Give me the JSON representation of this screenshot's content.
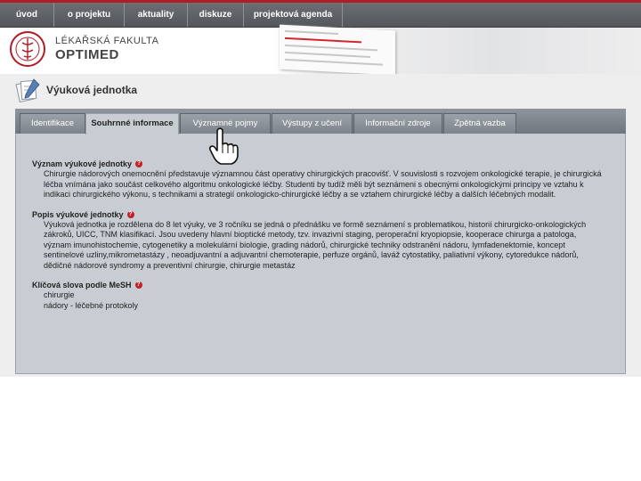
{
  "nav": {
    "items": [
      "úvod",
      "o projektu",
      "aktuality",
      "diskuze",
      "projektová agenda"
    ]
  },
  "logo": {
    "line1": "LÉKAŘSKÁ FAKULTA",
    "line2": "OPTIMED"
  },
  "page": {
    "title": "Výuková jednotka"
  },
  "tabs": [
    {
      "label": "Identifikace",
      "active": false
    },
    {
      "label": "Souhrnné informace",
      "active": true
    },
    {
      "label": "Významné pojmy",
      "active": false
    },
    {
      "label": "Výstupy z učení",
      "active": false
    },
    {
      "label": "Informační zdroje",
      "active": false
    },
    {
      "label": "Zpětná vazba",
      "active": false
    }
  ],
  "sections": {
    "vyznam": {
      "title": "Význam výukové jednotky",
      "text": "Chirurgie nádorových onemocnění představuje významnou část operativy chirurgických pracovišť. V souvislosti s rozvojem onkologické terapie, je chirurgická léčba vnímána jako součást celkového algoritmu onkologické léčby. Studenti by tudíž měli být seznámeni s obecnými onkologickými principy ve vztahu k indikaci chirurgického výkonu, s technikami a strategií onkologicko-chirurgické léčby a se vztahem chirurgické léčby a dalších léčebných modalit."
    },
    "popis": {
      "title": "Popis výukové jednotky",
      "text": "Výuková jednotka je rozdělena do 8 let výuky, ve 3 ročníku se jedná o přednášku ve formě seznámení s problematikou, historií chirurgicko-onkologických zákroků, UICC, TNM klasifikací. Jsou uvedeny hlavní bioptické metody, tzv. invazivní staging, peroperační kryopiopsie, kooperace chirurga a patologa, význam imunohistochemie, cytogenetiky a molekulární biologie, grading nádorů, chirurgické techniky odstranění nádoru, lymfadenektomie, koncept sentinelové uzliny,mikrometastázy , neoadjuvantní a adjuvantní chemoterapie, perfuze orgánů, laváž cytostatiky, paliativní výkony, cytoredukce nádorů, dědičné nádorové syndromy a preventivní chirurgie, chirurgie metastáz"
    },
    "klicova": {
      "title": "Klíčová slova podle MeSH",
      "items": [
        "chirurgie",
        "nádory - léčebné protokoly"
      ]
    }
  },
  "icons": {
    "help": "?"
  },
  "colors": {
    "brand_red": "#b01c24",
    "nav_bg": "#5f6267",
    "panel_bg": "#c8cdd3"
  }
}
